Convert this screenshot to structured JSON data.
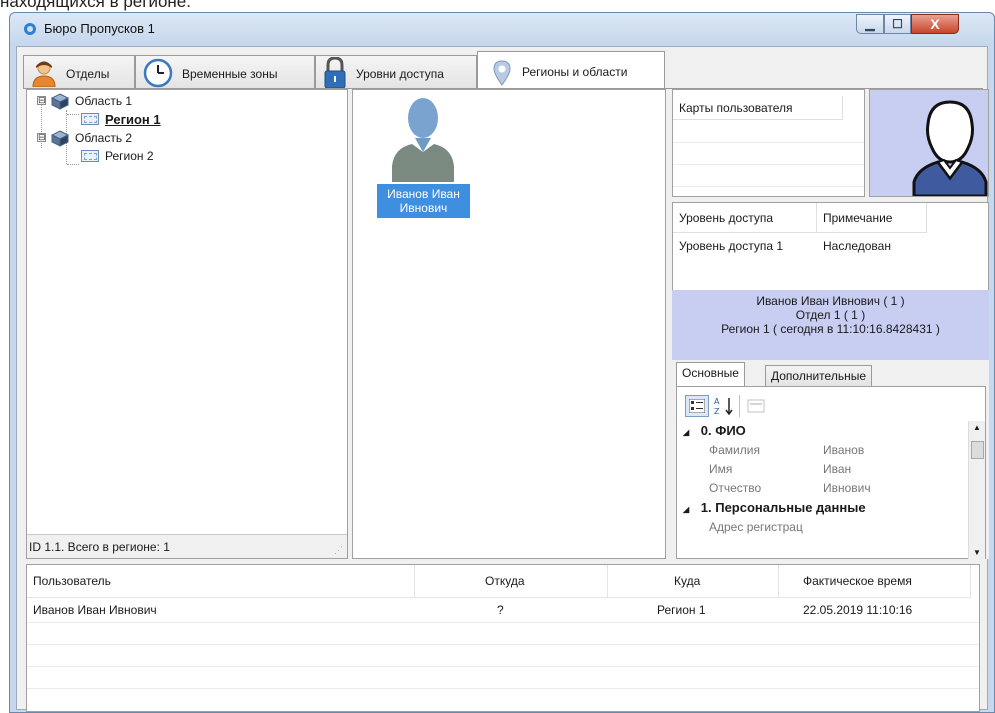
{
  "caption_text": "находящихся в регионе.",
  "window": {
    "title": "Бюро Пропусков 1",
    "btn_min": "▁",
    "btn_max": "☐",
    "btn_close": "X"
  },
  "tabs": [
    {
      "label": "Отделы",
      "icon": "user-icon"
    },
    {
      "label": "Временные зоны",
      "icon": "clock-icon"
    },
    {
      "label": "Уровни доступа",
      "icon": "padlock-icon"
    },
    {
      "label": "Регионы и области",
      "icon": "map-pin-icon",
      "active": true
    }
  ],
  "tree": {
    "items": [
      {
        "label": "Область 1",
        "expander": "⊟"
      },
      {
        "label": "Регион 1",
        "bold": true
      },
      {
        "label": "Область 2",
        "expander": "⊟"
      },
      {
        "label": "Регион 2"
      }
    ],
    "status": "ID 1.1. Всего в регионе: 1"
  },
  "user_card": {
    "name": "Иванов Иван Ивнович"
  },
  "cards_table": {
    "header": "Карты пользователя"
  },
  "access_table": {
    "headers": [
      "Уровень доступа",
      "Примечание"
    ],
    "rows": [
      [
        "Уровень доступа 1",
        "Наследован"
      ]
    ]
  },
  "user_info": {
    "line1": "Иванов Иван Ивнович ( 1 )",
    "line2": "Отдел 1 ( 1 )",
    "line3": "Регион 1 ( сегодня в 11:10:16.8428431 )"
  },
  "property_tabs": [
    "Основные",
    "Дополнительные"
  ],
  "properties": {
    "categories": [
      {
        "label": "0. ФИО",
        "arrow": "◢",
        "rows": [
          {
            "name": "Фамилия",
            "value": "Иванов"
          },
          {
            "name": "Имя",
            "value": "Иван"
          },
          {
            "name": "Отчество",
            "value": "Ивнович"
          }
        ]
      },
      {
        "label": "1. Персональные данные",
        "arrow": "◢",
        "rows": [
          {
            "name": "Адрес регистрац",
            "value": ""
          }
        ]
      }
    ]
  },
  "toolbar": {
    "sort_label": "A\nZ"
  },
  "log_table": {
    "headers": [
      "Пользователь",
      "Откуда",
      "Куда",
      "Фактическое время"
    ],
    "rows": [
      [
        "Иванов Иван Ивнович",
        "?",
        "Регион 1",
        "22.05.2019 11:10:16"
      ]
    ]
  },
  "colors": {
    "selection": "#3e8fe0",
    "info_bg": "#c8cdf2",
    "avatar_bg": "#c8cdf2"
  }
}
